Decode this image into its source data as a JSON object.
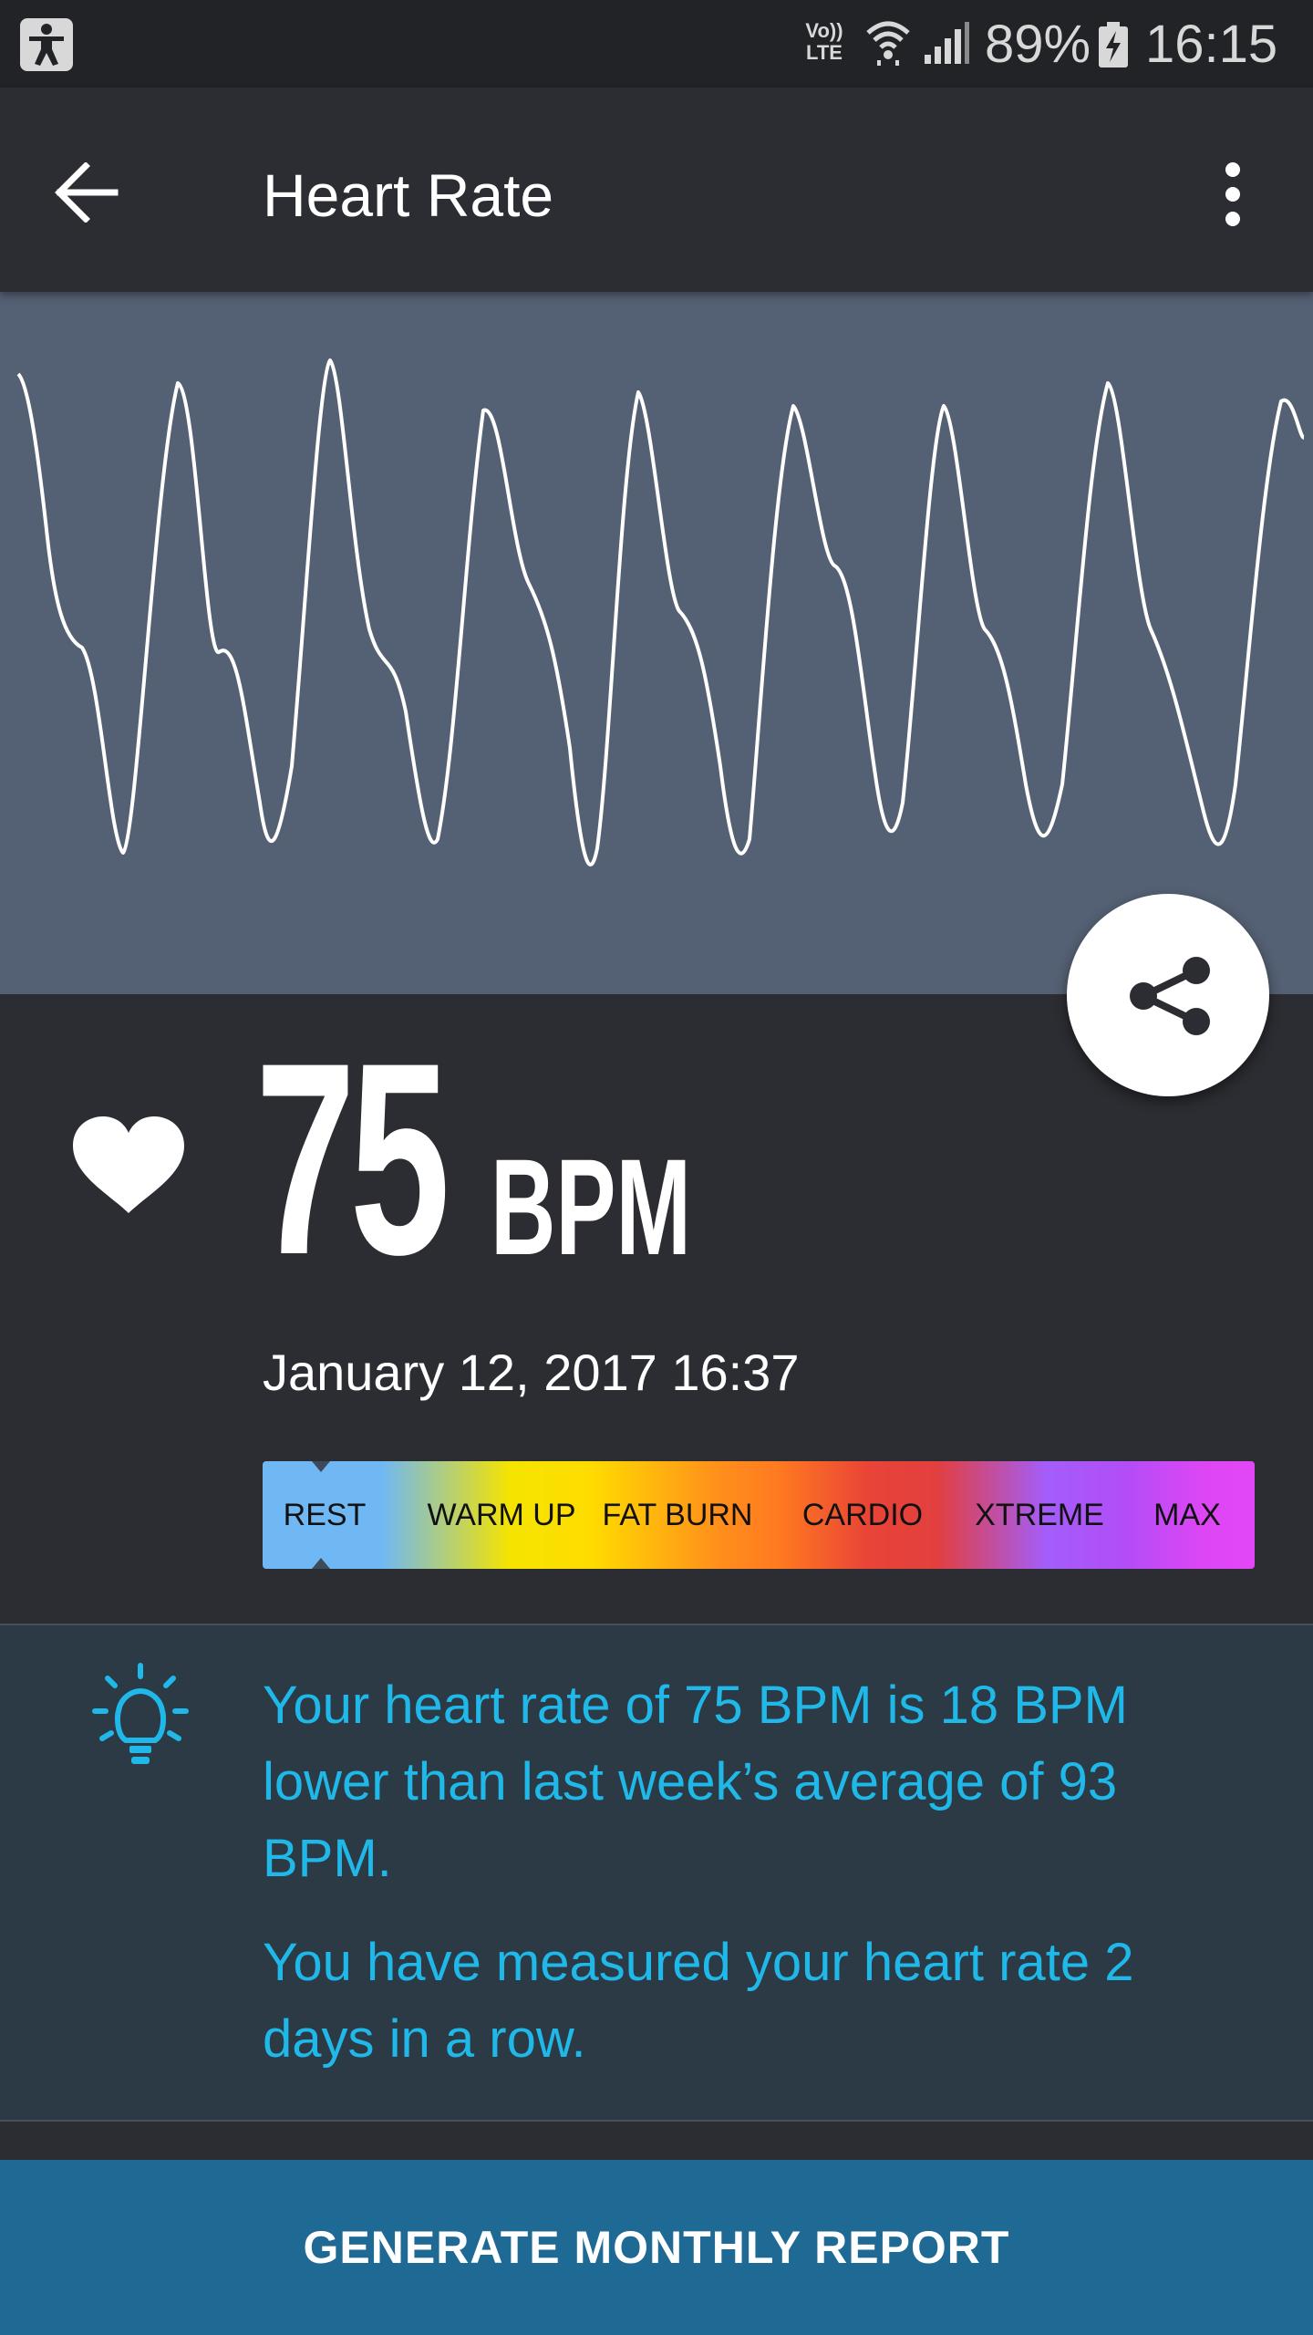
{
  "status_bar": {
    "volte_line1": "Vo))",
    "volte_line2": "LTE",
    "battery_percent": "89%",
    "time": "16:15",
    "icons": [
      "accessibility-icon",
      "volte-icon",
      "wifi-icon",
      "signal-icon",
      "battery-charging-icon"
    ]
  },
  "app_bar": {
    "title": "Heart Rate",
    "back_icon": "arrow-left-icon",
    "menu_icon": "more-vertical-icon"
  },
  "waveform": {
    "line_color": "#ffffff",
    "background": "#546073"
  },
  "share": {
    "icon": "share-icon"
  },
  "reading": {
    "icon": "heart-icon",
    "value": "75",
    "unit": "BPM",
    "date": "January 12, 2017 16:37"
  },
  "zones": {
    "selected": "REST",
    "items": [
      {
        "label": "REST",
        "color": "#6fb8f4"
      },
      {
        "label": "WARM UP",
        "color": "#ffdc00"
      },
      {
        "label": "FAT BURN",
        "color": "#ff7a20"
      },
      {
        "label": "CARDIO",
        "color": "#e23f3f"
      },
      {
        "label": "XTREME",
        "color": "#a35dfa"
      },
      {
        "label": "MAX",
        "color": "#e247f6"
      }
    ]
  },
  "insight": {
    "icon": "lightbulb-icon",
    "paragraph1": "Your heart rate of 75 BPM is 18 BPM lower than last week’s average of 93 BPM.",
    "paragraph2": "You have measured your heart rate 2 days in a row.",
    "color": "#1fb8e8"
  },
  "footer": {
    "button_label": "GENERATE MONTHLY REPORT",
    "color": "#1e6a94"
  }
}
